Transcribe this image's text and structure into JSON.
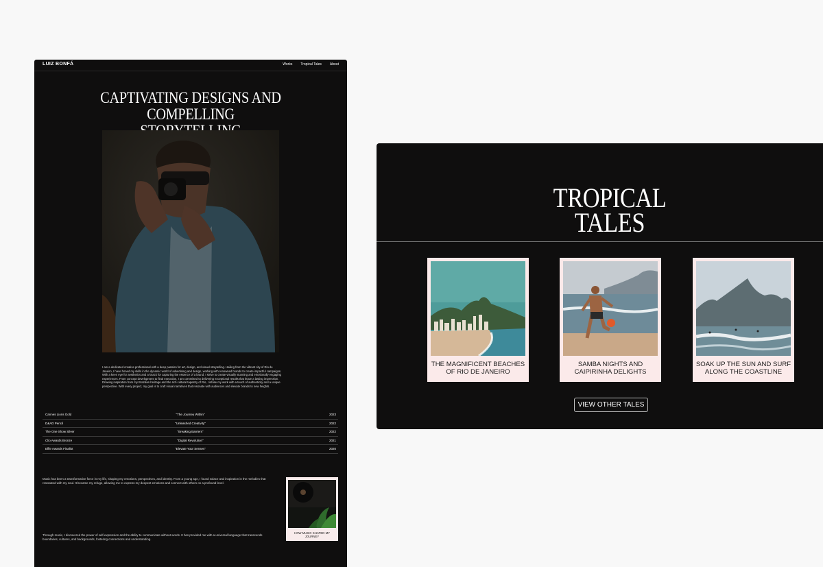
{
  "portfolio": {
    "brand": "LUIZ BONFÁ",
    "nav": [
      "Works",
      "Tropical Tales",
      "About"
    ],
    "hero_title_line1": "CAPTIVATING DESIGNS AND",
    "hero_title_line2": "COMPELLING STORYTELLING",
    "bio": "I am a dedicated creative professional with a deep passion for art, design, and visual storytelling. Hailing from the vibrant city of Rio de Janeiro, I have honed my skills in the dynamic world of advertising and design, working with renowned brands to create impactful campaigns. With a keen eye for aesthetics and a knack for capturing the essence of a brand, I strive to create visually stunning and emotionally engaging experiences. From concept development to final execution, I am committed to delivering exceptional results that leave a lasting impression. Drawing inspiration from my Brazilian heritage and the rich cultural tapestry of Rio, I infuse my work with a touch of authenticity and a unique perspective. With every project, my goal is to craft visual narratives that resonate with audiences and elevate brands to new heights.",
    "awards": [
      {
        "name": "Cannes Lions Gold",
        "project": "\"The Journey Within\"",
        "year": "2023"
      },
      {
        "name": "D&AD Pencil",
        "project": "\"Unleashed Creativity\"",
        "year": "2022"
      },
      {
        "name": "The One Show Silver",
        "project": "\"Breaking Barriers\"",
        "year": "2022"
      },
      {
        "name": "Clio Awards Bronze",
        "project": "\"Digital Revolution\"",
        "year": "2021"
      },
      {
        "name": "Effie Awards Finalist",
        "project": "\"Elevate Your Senses\"",
        "year": "2020"
      }
    ],
    "music_p1": "Music has been a transformative force in my life, shaping my emotions, perspectives, and identity. From a young age, I found solace and inspiration in the melodies that resonated with my soul. It became my refuge, allowing me to express my deepest emotions and connect with others on a profound level.",
    "music_p2": "Through music, I discovered the power of self-expression and the ability to communicate without words. It has provided me with a universal language that transcends boundaries, cultures, and backgrounds, fostering connections and understanding.",
    "music_card_caption": "HOW MUSIC SHAPED MY JOURNEY"
  },
  "tropical": {
    "title_line1": "TROPICAL",
    "title_line2": "TALES",
    "cards": [
      {
        "caption": "THE MAGNIFICENT BEACHES OF RIO DE JANEIRO",
        "icon": "beach-city-photo"
      },
      {
        "caption": "SAMBA NIGHTS AND CAIPIRINHA DELIGHTS",
        "icon": "beach-football-photo"
      },
      {
        "caption": "SOAK UP THE SUN AND SURF ALONG THE COASTLINE",
        "icon": "surf-mountains-photo"
      }
    ],
    "button": "VIEW OTHER TALES"
  },
  "colors": {
    "page_bg": "#f8f8f8",
    "window_bg": "#0f0e0e",
    "card_bg": "#fbeaea",
    "text": "#ffffff"
  }
}
